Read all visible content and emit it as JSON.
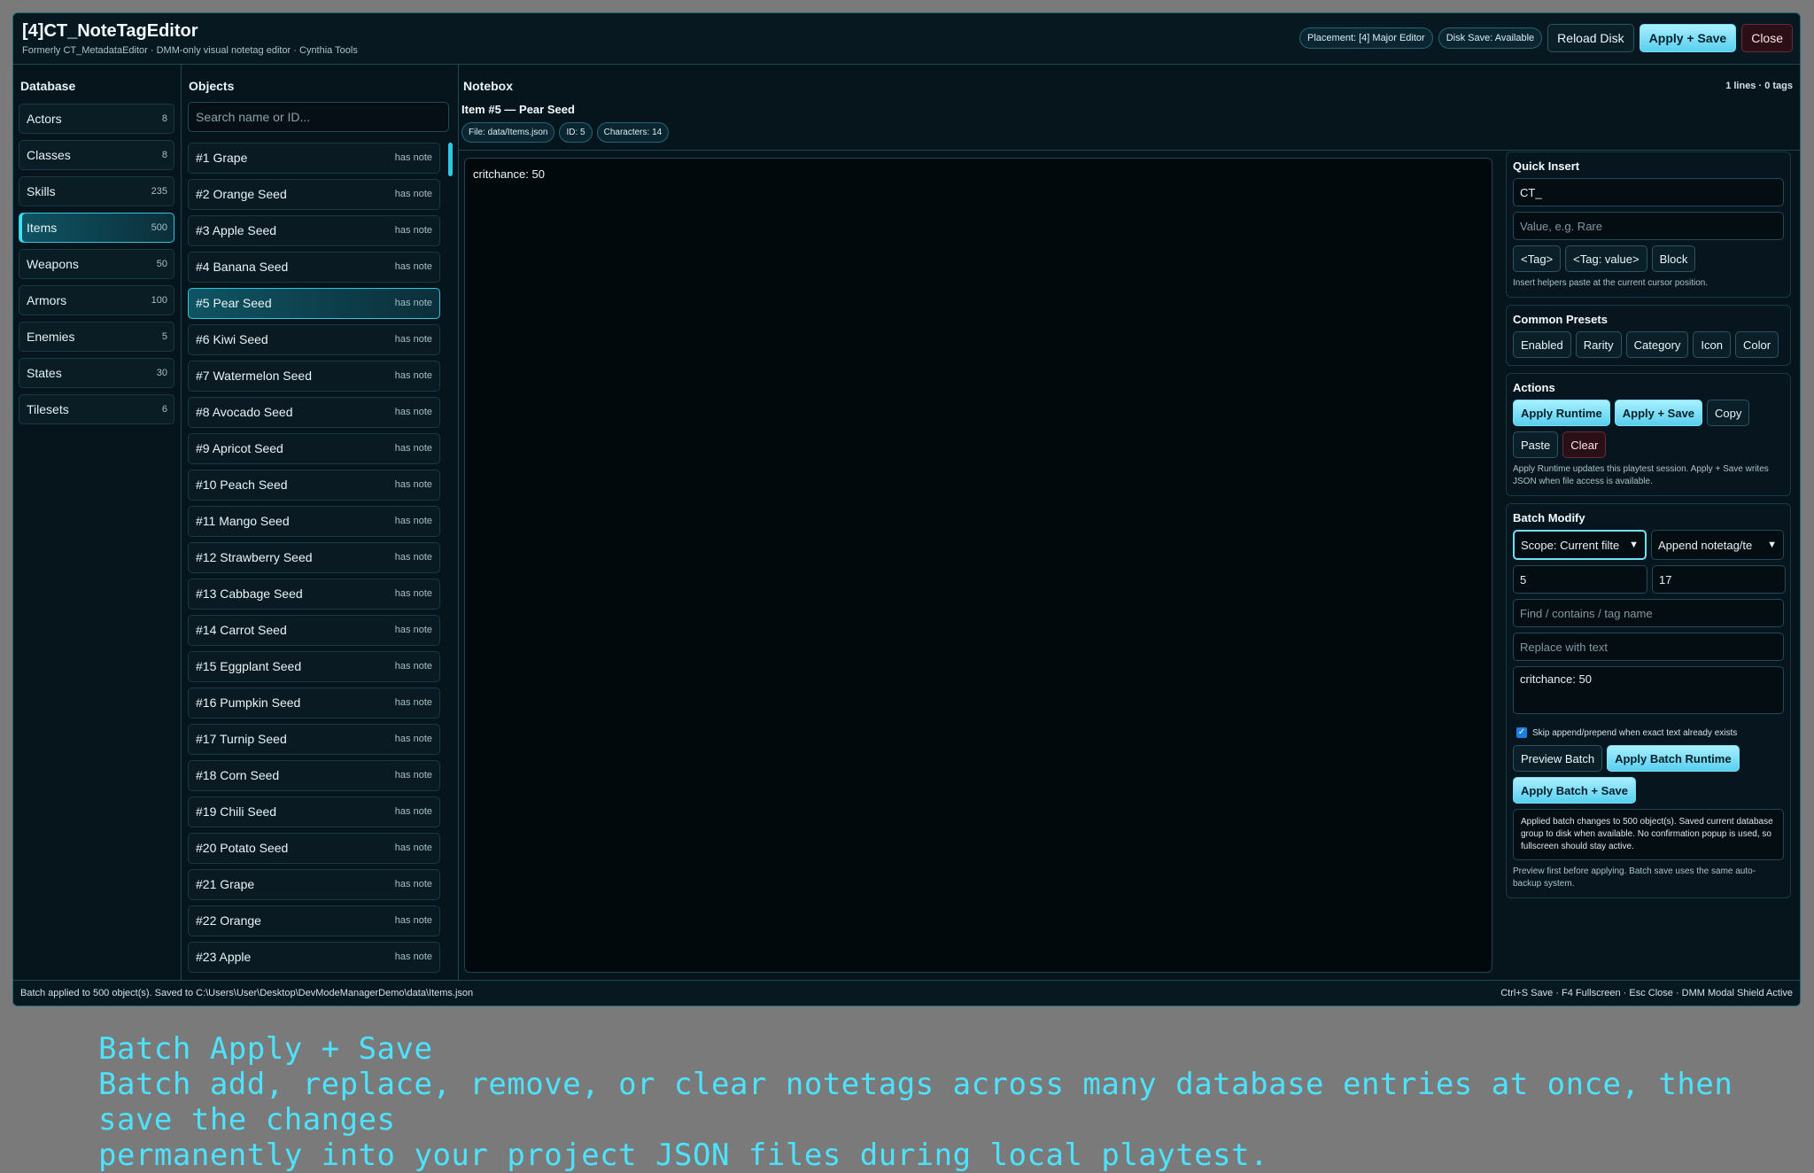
{
  "app": {
    "title": "[4]CT_NoteTagEditor",
    "subtitle": "Formerly CT_MetadataEditor · DMM-only visual notetag editor · Cynthia Tools",
    "placement_pill": "Placement: [4] Major Editor",
    "disk_pill": "Disk Save: Available",
    "reload_label": "Reload Disk",
    "apply_save_label": "Apply + Save",
    "close_label": "Close"
  },
  "database": {
    "heading": "Database",
    "items": [
      {
        "label": "Actors",
        "count": "8"
      },
      {
        "label": "Classes",
        "count": "8"
      },
      {
        "label": "Skills",
        "count": "235"
      },
      {
        "label": "Items",
        "count": "500"
      },
      {
        "label": "Weapons",
        "count": "50"
      },
      {
        "label": "Armors",
        "count": "100"
      },
      {
        "label": "Enemies",
        "count": "5"
      },
      {
        "label": "States",
        "count": "30"
      },
      {
        "label": "Tilesets",
        "count": "6"
      }
    ]
  },
  "objects": {
    "heading": "Objects",
    "search_placeholder": "Search name or ID...",
    "note_label": "has note",
    "items": [
      "#1 Grape",
      "#2 Orange Seed",
      "#3 Apple Seed",
      "#4 Banana Seed",
      "#5 Pear Seed",
      "#6 Kiwi Seed",
      "#7 Watermelon Seed",
      "#8 Avocado Seed",
      "#9 Apricot Seed",
      "#10 Peach Seed",
      "#11 Mango Seed",
      "#12 Strawberry Seed",
      "#13 Cabbage Seed",
      "#14 Carrot Seed",
      "#15 Eggplant Seed",
      "#16 Pumpkin Seed",
      "#17 Turnip Seed",
      "#18 Corn Seed",
      "#19 Chili Seed",
      "#20 Potato Seed",
      "#21 Grape",
      "#22 Orange",
      "#23 Apple"
    ]
  },
  "notebox": {
    "heading": "Notebox",
    "meta": "1 lines · 0 tags",
    "item_title": "Item #5 — Pear Seed",
    "chips": [
      "File: data/Items.json",
      "ID: 5",
      "Characters: 14"
    ],
    "content": "critchance: 50"
  },
  "quick_insert": {
    "heading": "Quick Insert",
    "tag_value": "CT_",
    "value_placeholder": "Value, e.g. Rare",
    "buttons": [
      "<Tag>",
      "<Tag: value>",
      "Block"
    ],
    "help": "Insert helpers paste at the current cursor position."
  },
  "presets": {
    "heading": "Common Presets",
    "buttons": [
      "Enabled",
      "Rarity",
      "Category",
      "Icon",
      "Color"
    ]
  },
  "actions": {
    "heading": "Actions",
    "apply_runtime": "Apply Runtime",
    "apply_save": "Apply + Save",
    "copy": "Copy",
    "paste": "Paste",
    "clear": "Clear",
    "help": "Apply Runtime updates this playtest session. Apply + Save writes JSON when file access is available."
  },
  "batch": {
    "heading": "Batch Modify",
    "scope": "Scope: Current filte",
    "mode": "Append notetag/te",
    "from": "5",
    "to": "17",
    "find_placeholder": "Find / contains / tag name",
    "replace_placeholder": "Replace with text",
    "text": "critchance: 50",
    "skip_label": "Skip append/prepend when exact text already exists",
    "preview": "Preview Batch",
    "apply_runtime": "Apply Batch Runtime",
    "apply_save": "Apply Batch + Save",
    "result": "Applied batch changes to 500 object(s). Saved current database group to disk when available. No confirmation popup is used, so fullscreen should stay active.",
    "help": "Preview first before applying. Batch save uses the same auto-backup system."
  },
  "status": {
    "left": "Batch applied to 500 object(s). Saved to C:\\Users\\User\\Desktop\\DevModeManagerDemo\\data\\Items.json",
    "right": "Ctrl+S Save · F4 Fullscreen · Esc Close · DMM Modal Shield Active"
  },
  "caption": {
    "line1": "Batch Apply + Save",
    "line2": "Batch add, replace, remove, or clear notetags across many database entries at once, then save the changes",
    "line3": "permanently into your project JSON files during local playtest."
  }
}
